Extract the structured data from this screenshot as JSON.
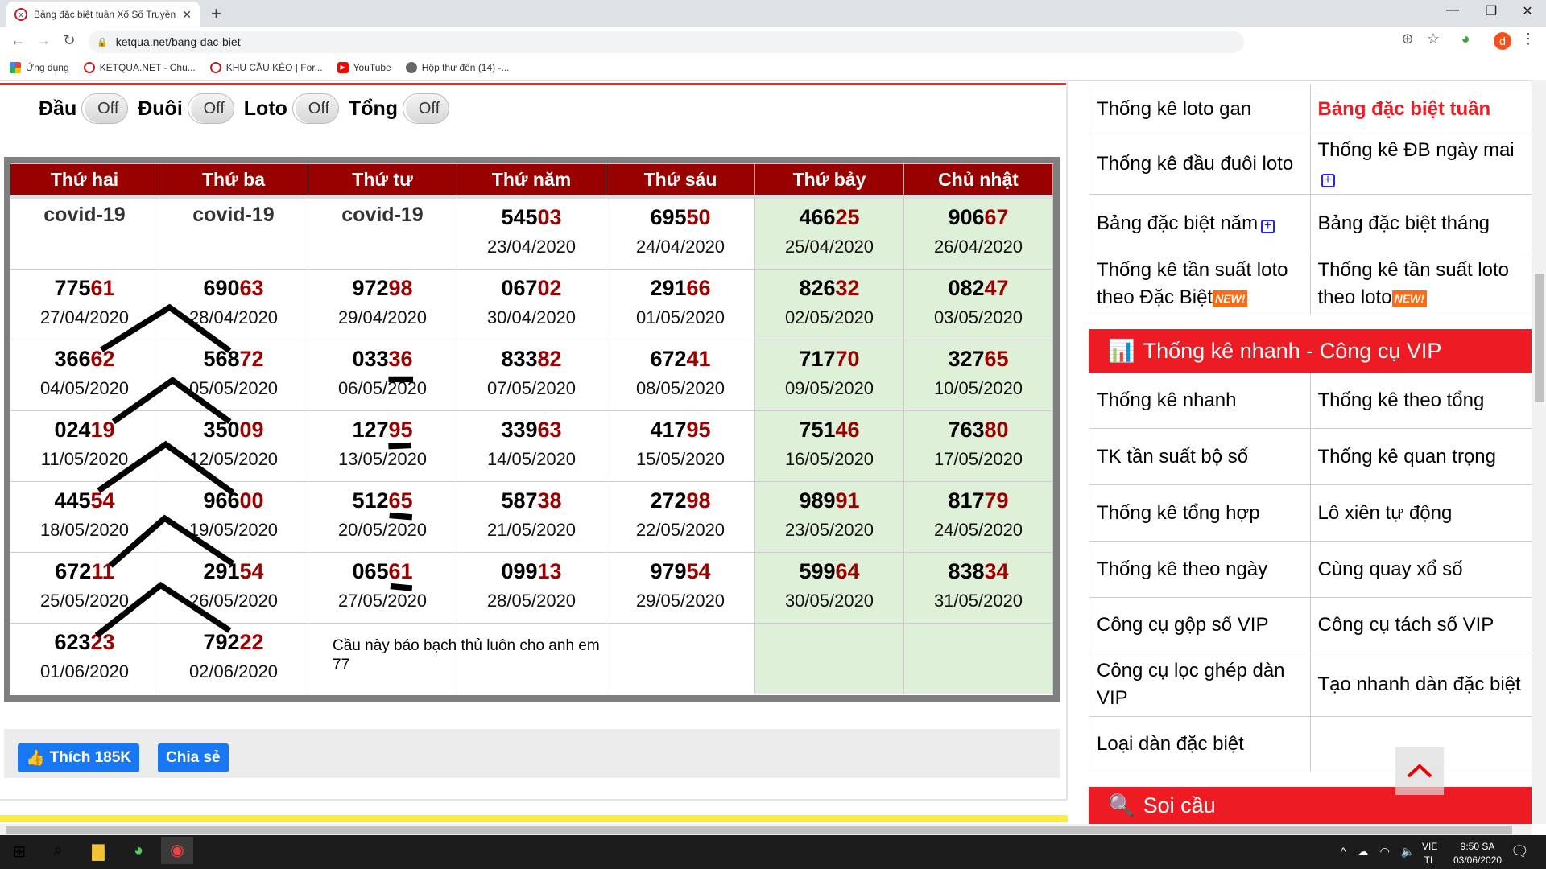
{
  "browser": {
    "tab_title": "Bảng đặc biệt tuần Xổ Số Truyền",
    "url": "ketqua.net/bang-dac-biet",
    "profile_initial": "d",
    "bookmarks": [
      "Ứng dụng",
      "KETQUA.NET - Chu...",
      "KHU CẦU KÈO | For...",
      "YouTube",
      "Hộp thư đến (14) -..."
    ]
  },
  "toggles": [
    {
      "label": "Đầu",
      "state": "Off"
    },
    {
      "label": "Đuôi",
      "state": "Off"
    },
    {
      "label": "Loto",
      "state": "Off"
    },
    {
      "label": "Tổng",
      "state": "Off"
    }
  ],
  "table": {
    "headers": [
      "Thứ hai",
      "Thứ ba",
      "Thứ tư",
      "Thứ năm",
      "Thứ sáu",
      "Thứ bảy",
      "Chủ nhật"
    ],
    "colors": {
      "header_bg": "#990000",
      "tail": "#990000",
      "weekend_bg": "#dff0d8"
    },
    "rows": [
      [
        {
          "text": "covid-19"
        },
        {
          "text": "covid-19"
        },
        {
          "text": "covid-19"
        },
        {
          "num": "54503",
          "date": "23/04/2020"
        },
        {
          "num": "69550",
          "date": "24/04/2020"
        },
        {
          "num": "46625",
          "date": "25/04/2020"
        },
        {
          "num": "90667",
          "date": "26/04/2020"
        }
      ],
      [
        {
          "num": "77561",
          "date": "27/04/2020"
        },
        {
          "num": "69063",
          "date": "28/04/2020"
        },
        {
          "num": "97298",
          "date": "29/04/2020"
        },
        {
          "num": "06702",
          "date": "30/04/2020"
        },
        {
          "num": "29166",
          "date": "01/05/2020"
        },
        {
          "num": "82632",
          "date": "02/05/2020"
        },
        {
          "num": "08247",
          "date": "03/05/2020"
        }
      ],
      [
        {
          "num": "36662",
          "date": "04/05/2020"
        },
        {
          "num": "56872",
          "date": "05/05/2020"
        },
        {
          "num": "03336",
          "date": "06/05/2020"
        },
        {
          "num": "83382",
          "date": "07/05/2020"
        },
        {
          "num": "67241",
          "date": "08/05/2020"
        },
        {
          "num": "71770",
          "date": "09/05/2020"
        },
        {
          "num": "32765",
          "date": "10/05/2020"
        }
      ],
      [
        {
          "num": "02419",
          "date": "11/05/2020"
        },
        {
          "num": "35009",
          "date": "12/05/2020"
        },
        {
          "num": "12795",
          "date": "13/05/2020"
        },
        {
          "num": "33963",
          "date": "14/05/2020"
        },
        {
          "num": "41795",
          "date": "15/05/2020"
        },
        {
          "num": "75146",
          "date": "16/05/2020"
        },
        {
          "num": "76380",
          "date": "17/05/2020"
        }
      ],
      [
        {
          "num": "44554",
          "date": "18/05/2020"
        },
        {
          "num": "96600",
          "date": "19/05/2020"
        },
        {
          "num": "51265",
          "date": "20/05/2020"
        },
        {
          "num": "58738",
          "date": "21/05/2020"
        },
        {
          "num": "27298",
          "date": "22/05/2020"
        },
        {
          "num": "98991",
          "date": "23/05/2020"
        },
        {
          "num": "81779",
          "date": "24/05/2020"
        }
      ],
      [
        {
          "num": "67211",
          "date": "25/05/2020"
        },
        {
          "num": "29154",
          "date": "26/05/2020"
        },
        {
          "num": "06561",
          "date": "27/05/2020"
        },
        {
          "num": "09913",
          "date": "28/05/2020"
        },
        {
          "num": "97954",
          "date": "29/05/2020"
        },
        {
          "num": "59964",
          "date": "30/05/2020"
        },
        {
          "num": "83834",
          "date": "31/05/2020"
        }
      ],
      [
        {
          "num": "62323",
          "date": "01/06/2020"
        },
        {
          "num": "79222",
          "date": "02/06/2020"
        },
        {
          "note": "Cầu này báo bạch thủ luôn cho anh em  77"
        },
        {},
        {},
        {},
        {}
      ]
    ]
  },
  "share": {
    "like_label": "Thích 185K",
    "share_label": "Chia sẻ"
  },
  "sidebar": {
    "links": [
      [
        {
          "label": "Thống kê loto gan"
        },
        {
          "label": "Bảng đặc biệt tuần",
          "active": true
        }
      ],
      [
        {
          "label": "Thống kê đầu đuôi loto"
        },
        {
          "label": "Thống kê ĐB ngày mai",
          "plus": true
        }
      ],
      [
        {
          "label": "Bảng đặc biệt năm",
          "plus": true
        },
        {
          "label": "Bảng đặc biệt tháng"
        }
      ],
      [
        {
          "label": "Thống kê tần suất loto theo Đặc Biệt",
          "new": "NEW!"
        },
        {
          "label": "Thống kê tần suất loto theo loto",
          "new": "NEW!"
        }
      ]
    ],
    "vip_title": "Thống kê nhanh - Công cụ VIP",
    "vip_links": [
      [
        "Thống kê nhanh",
        "Thống kê theo tổng"
      ],
      [
        "TK tần suất bộ số",
        "Thống kê quan trọng"
      ],
      [
        "Thống kê tổng hợp",
        "Lô xiên tự động"
      ],
      [
        "Thống kê theo ngày",
        "Cùng quay xổ số"
      ],
      [
        "Công cụ gộp số VIP",
        "Công cụ tách số VIP"
      ],
      [
        "Công cụ lọc ghép dàn VIP",
        "Tạo nhanh dàn đặc biệt"
      ],
      [
        "Loại dàn đặc biệt",
        ""
      ]
    ],
    "soi_cau_title": "Soi cầu",
    "accent": "#ed1c24",
    "active_color": "#ed1c24"
  },
  "taskbar": {
    "lang1": "VIE",
    "lang2": "TL",
    "time": "9:50 SA",
    "date": "03/06/2020"
  }
}
